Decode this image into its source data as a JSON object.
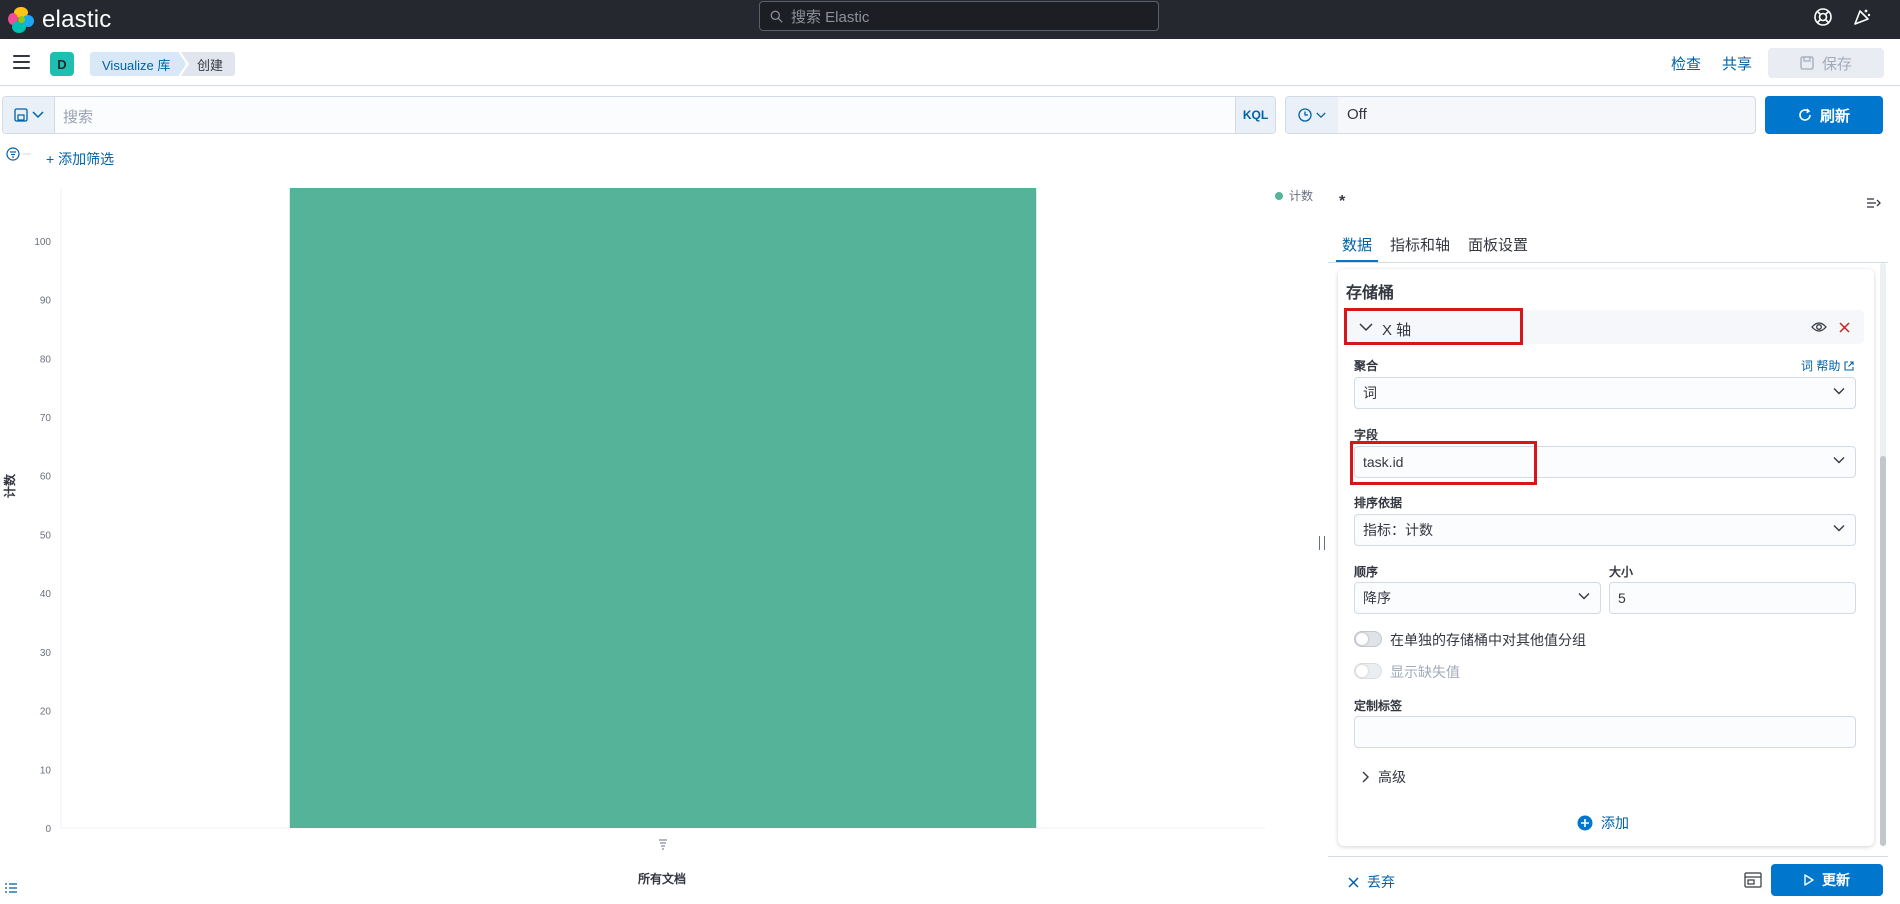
{
  "header": {
    "brand": "elastic",
    "search_placeholder": "搜索 Elastic"
  },
  "nav": {
    "space_initial": "D",
    "breadcrumbs": [
      "Visualize 库",
      "创建"
    ],
    "inspect": "检查",
    "share": "共享",
    "save": "保存"
  },
  "query": {
    "placeholder": "搜索",
    "language": "KQL",
    "refresh_interval": "Off",
    "refresh_label": "刷新",
    "add_filter": "+ 添加筛选"
  },
  "chart_data": {
    "type": "bar",
    "categories": [
      "所有文档"
    ],
    "values": [
      109
    ],
    "xlabel": "所有文档",
    "ylabel": "计数",
    "ylim": [
      0,
      109
    ],
    "yticks": [
      0,
      10,
      20,
      30,
      40,
      50,
      60,
      70,
      80,
      90,
      100
    ],
    "series": [
      {
        "name": "计数",
        "values": [
          109
        ],
        "color": "#54b399"
      }
    ],
    "legend_position": "top-right",
    "grid": false
  },
  "sidebar": {
    "title": "*",
    "tabs": [
      "数据",
      "指标和轴",
      "面板设置"
    ],
    "active_tab": "数据",
    "section_title": "存储桶",
    "bucket_label": "X 轴",
    "aggregation_label": "聚合",
    "aggregation_help": "词 帮助",
    "aggregation_value": "词",
    "field_label": "字段",
    "field_value": "task.id",
    "order_by_label": "排序依据",
    "order_by_value": "指标：计数",
    "order_label": "顺序",
    "order_value": "降序",
    "size_label": "大小",
    "size_value": "5",
    "group_other_label": "在单独的存储桶中对其他值分组",
    "show_missing_label": "显示缺失值",
    "custom_label_label": "定制标签",
    "custom_label_value": "",
    "advanced_label": "高级",
    "add_label": "添加",
    "discard_label": "丢弃",
    "update_label": "更新"
  },
  "colors": {
    "accent": "#0077cc",
    "bar": "#54b399",
    "highlight": "#d6171a"
  }
}
